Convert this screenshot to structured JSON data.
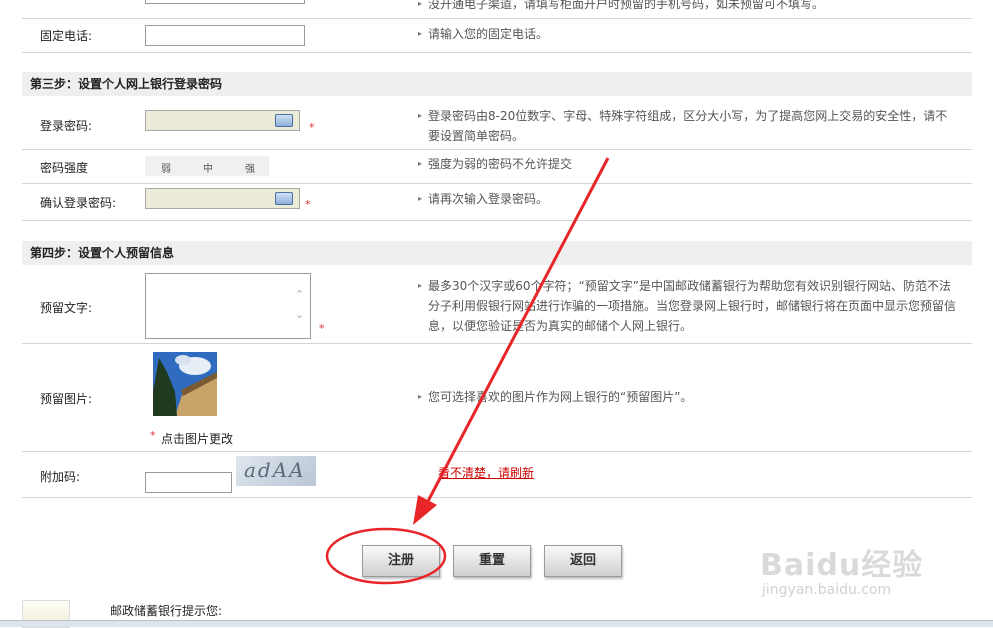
{
  "top_hint": "没开通电子渠道，请填写柜面开户时预留的手机号码，如未预留可不填写。",
  "fixed_phone": {
    "label": "固定电话:",
    "hint": "请输入您的固定电话。"
  },
  "step3": {
    "title": "第三步：设置个人网上银行登录密码",
    "login_password": {
      "label": "登录密码:",
      "hint": "登录密码由8-20位数字、字母、特殊字符组成，区分大小写，为了提高您网上交易的安全性，请不要设置简单密码。"
    },
    "strength": {
      "label": "密码强度",
      "levels": [
        "弱",
        "中",
        "强"
      ],
      "hint": "强度为弱的密码不允许提交"
    },
    "confirm_password": {
      "label": "确认登录密码:",
      "hint": "请再次输入登录密码。"
    }
  },
  "step4": {
    "title": "第四步：设置个人预留信息",
    "reserved_text": {
      "label": "预留文字:",
      "hint": "最多30个汉字或60个字符；“预留文字”是中国邮政储蓄银行为帮助您有效识别银行网站、防范不法分子利用假银行网站进行诈骗的一项措施。当您登录网上银行时，邮储银行将在页面中显示您预留信息，以便您验证是否为真实的邮储个人网上银行。"
    },
    "reserved_image": {
      "label": "预留图片:",
      "change_text": "点击图片更改",
      "hint": "您可选择喜欢的图片作为网上银行的“预留图片”。"
    },
    "captcha": {
      "label": "附加码:",
      "code": "adAA",
      "refresh_link": "看不清楚，请刷新"
    }
  },
  "required_mark": "*",
  "buttons": {
    "register": "注册",
    "reset": "重置",
    "back": "返回"
  },
  "notice_title": "邮政储蓄银行提示您:",
  "watermark": {
    "brand": "Baidu经验",
    "url": "jingyan.baidu.com"
  },
  "colors": {
    "section_bg": "#efefef",
    "arrow": "#e8262a",
    "link": "#cc0000",
    "pwd_field": "#ecead9"
  }
}
